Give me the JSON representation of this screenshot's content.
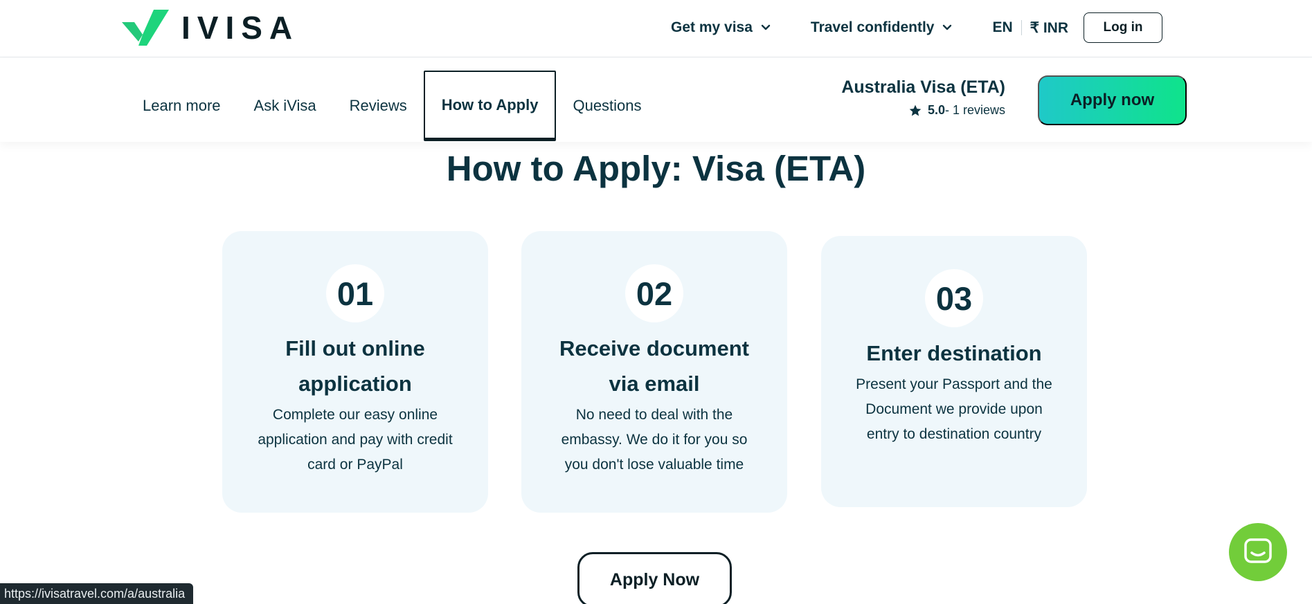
{
  "header": {
    "logo_text": "IVISA",
    "nav": {
      "get_my_visa": "Get my visa",
      "travel_confidently": "Travel confidently",
      "language": "EN",
      "currency": "₹ INR"
    },
    "login_label": "Log in"
  },
  "subnav": {
    "tabs": [
      {
        "label": "Learn more"
      },
      {
        "label": "Ask iVisa"
      },
      {
        "label": "Reviews"
      },
      {
        "label": "How to Apply"
      },
      {
        "label": "Questions"
      }
    ],
    "active_tab": "How to Apply",
    "product": {
      "name": "Australia Visa (ETA)",
      "rating_value": "5.0",
      "rating_suffix": "- 1 reviews"
    },
    "apply_label": "Apply now"
  },
  "main": {
    "title": "How to Apply: Visa (ETA)",
    "steps": [
      {
        "num": "01",
        "title": "Fill out online application",
        "desc": "Complete our easy online application and pay with credit card or PayPal"
      },
      {
        "num": "02",
        "title": "Receive document via email",
        "desc": "No need to deal with the embassy. We do it for you so you don't lose valuable time"
      },
      {
        "num": "03",
        "title": "Enter destination",
        "desc": "Present your Passport and the Document we provide upon entry to destination country"
      }
    ],
    "apply_label": "Apply Now"
  },
  "status_url": "https://ivisatravel.com/a/australia",
  "colors": {
    "brand_green": "#1ed47c",
    "text_dark": "#0c3340",
    "card_bg": "#eff7fb",
    "chat_green": "#72cd3a"
  },
  "icons": {
    "logo": "ivisa-check-logo",
    "dropdown": "chevron-down-icon",
    "rating": "star-icon",
    "chat": "chat-bubble-icon"
  }
}
